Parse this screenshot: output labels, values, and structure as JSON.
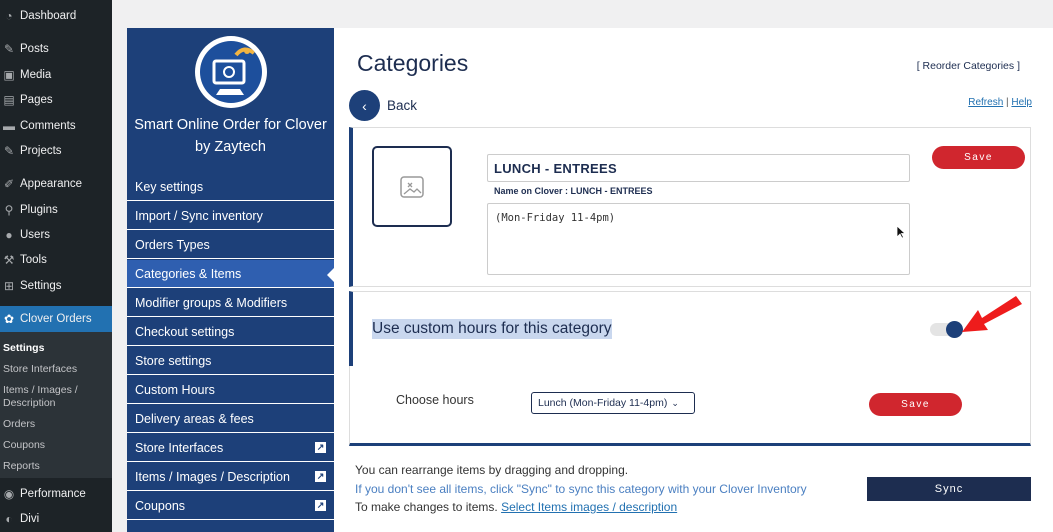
{
  "wp_menu": {
    "items": [
      {
        "label": "Dashboard",
        "icon": "dashboard-icon"
      },
      {
        "label": "Posts",
        "icon": "pin-icon"
      },
      {
        "label": "Media",
        "icon": "media-icon"
      },
      {
        "label": "Pages",
        "icon": "pages-icon"
      },
      {
        "label": "Comments",
        "icon": "comment-icon"
      },
      {
        "label": "Projects",
        "icon": "pin-icon"
      },
      {
        "label": "Appearance",
        "icon": "brush-icon"
      },
      {
        "label": "Plugins",
        "icon": "plug-icon"
      },
      {
        "label": "Users",
        "icon": "user-icon"
      },
      {
        "label": "Tools",
        "icon": "wrench-icon"
      },
      {
        "label": "Settings",
        "icon": "settings-icon"
      },
      {
        "label": "Clover Orders",
        "icon": "clover-icon"
      },
      {
        "label": "Performance",
        "icon": "performance-icon"
      },
      {
        "label": "Divi",
        "icon": "divi-icon"
      }
    ],
    "submenu": [
      "Settings",
      "Store Interfaces",
      "Items / Images / Description",
      "Orders",
      "Coupons",
      "Reports"
    ]
  },
  "plugin_nav": {
    "title": "Smart Online Order for Clover by Zaytech",
    "items": [
      {
        "label": "Key settings",
        "external": false
      },
      {
        "label": "Import / Sync inventory",
        "external": false
      },
      {
        "label": "Orders Types",
        "external": false
      },
      {
        "label": "Categories & Items",
        "external": false,
        "active": true
      },
      {
        "label": "Modifier groups & Modifiers",
        "external": false
      },
      {
        "label": "Checkout settings",
        "external": false
      },
      {
        "label": "Store settings",
        "external": false
      },
      {
        "label": "Custom Hours",
        "external": false
      },
      {
        "label": "Delivery areas & fees",
        "external": false
      },
      {
        "label": "Store Interfaces",
        "external": true
      },
      {
        "label": "Items / Images / Description",
        "external": true
      },
      {
        "label": "Coupons",
        "external": true
      }
    ]
  },
  "main": {
    "title": "Categories",
    "reorder_link": "[ Reorder Categories ]",
    "back_label": "Back",
    "refresh_label": "Refresh",
    "separator": "|",
    "help_label": "Help",
    "category_name": "LUNCH - ENTREES",
    "clover_name": "Name on Clover : LUNCH - ENTREES",
    "description": "(Mon-Friday 11-4pm)",
    "save_label": "Save",
    "custom_hours_label": "Use custom hours for this category",
    "custom_hours_enabled": true,
    "choose_hours_label": "Choose hours",
    "hours_selected": "Lunch (Mon-Friday 11-4pm)",
    "save2_label": "Save",
    "info_line_1": "You can rearrange items by dragging and dropping.",
    "info_line_2": "If you don't see all items, click \"Sync\" to sync this category with your Clover Inventory",
    "info_line_3_prefix": "To make changes to items.",
    "info_line_3_link": "Select Items images / description",
    "sync_label": "Sync"
  },
  "colors": {
    "wp_sidebar": "#1d2327",
    "plugin_nav": "#1d4079",
    "accent_red": "#d0262e",
    "sync_button": "#1d2d50"
  }
}
